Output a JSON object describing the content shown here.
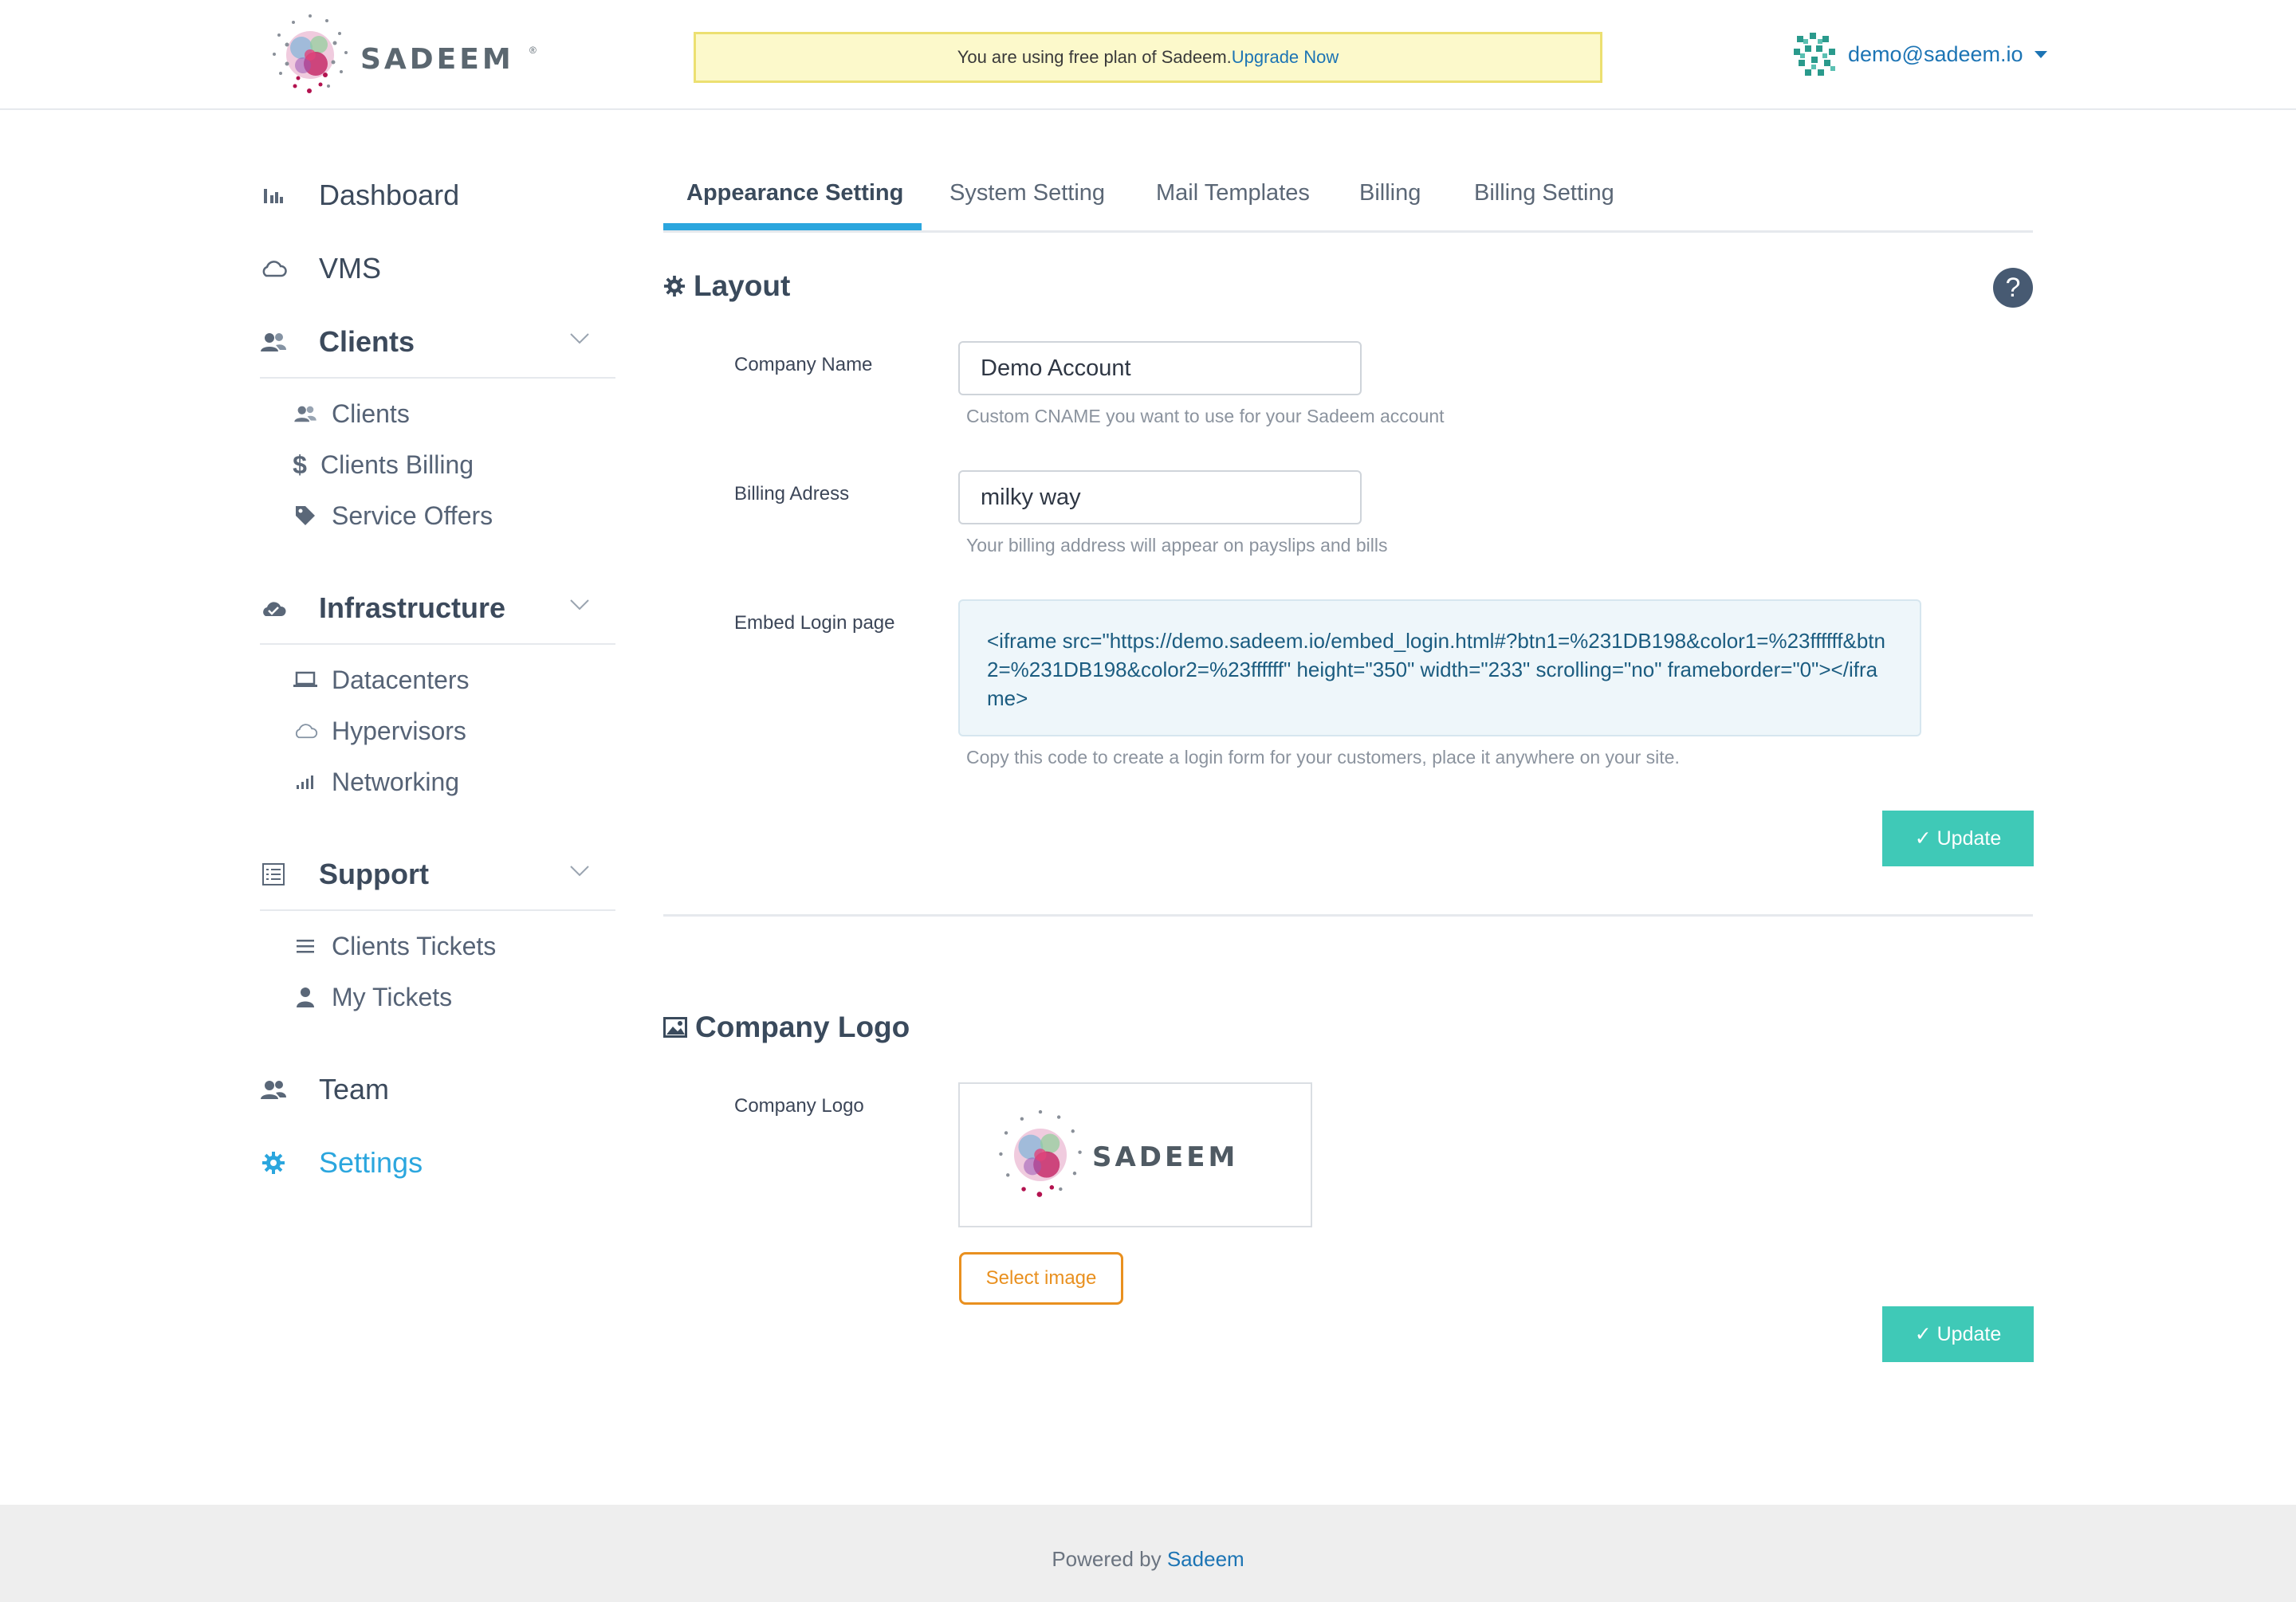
{
  "brand": {
    "name": "SADEEM",
    "reg_mark": "®"
  },
  "banner": {
    "text": "You are using free plan of Sadeem.",
    "link_label": "Upgrade Now"
  },
  "user": {
    "email": "demo@sadeem.io"
  },
  "sidebar": {
    "dashboard": "Dashboard",
    "vms": "VMS",
    "clients": {
      "label": "Clients",
      "items": [
        "Clients",
        "Clients Billing",
        "Service Offers"
      ]
    },
    "infrastructure": {
      "label": "Infrastructure",
      "items": [
        "Datacenters",
        "Hypervisors",
        "Networking"
      ]
    },
    "support": {
      "label": "Support",
      "items": [
        "Clients Tickets",
        "My Tickets"
      ]
    },
    "team": "Team",
    "settings": "Settings"
  },
  "tabs": [
    "Appearance Setting",
    "System Setting",
    "Mail Templates",
    "Billing",
    "Billing Setting"
  ],
  "layout_section": {
    "title": "Layout",
    "help": "?",
    "company_name": {
      "label": "Company Name",
      "value": "Demo Account",
      "help": "Custom CNAME you want to use for your Sadeem account"
    },
    "billing_address": {
      "label": "Billing Adress",
      "value": "milky way",
      "help": "Your billing address will appear on payslips and bills"
    },
    "embed_login": {
      "label": "Embed Login page",
      "code": "<iframe src=\"https://demo.sadeem.io/embed_login.html#?btn1=%231DB198&color1=%23ffffff&btn2=%231DB198&color2=%23ffffff\" height=\"350\" width=\"233\" scrolling=\"no\" frameborder=\"0\"></iframe>",
      "help": "Copy this code to create a login form for your customers, place it anywhere on your site."
    },
    "update_label": "✓ Update"
  },
  "logo_section": {
    "title": "Company Logo",
    "label": "Company Logo",
    "select_label": "Select image",
    "update_label": "✓ Update"
  },
  "footer": {
    "text": "Powered by ",
    "link": "Sadeem"
  },
  "colors": {
    "accent": "#2ba6de",
    "update": "#3fc9b7",
    "select": "#e9901f",
    "link": "#1c74b4"
  },
  "icons": {
    "dashboard": "bar-chart-icon",
    "vms": "cloud-icon",
    "clients": "users-icon",
    "clients_billing": "dollar-icon",
    "service_offers": "tag-icon",
    "infrastructure": "cloud-check-icon",
    "datacenters": "laptop-icon",
    "hypervisors": "cloud-icon",
    "networking": "signal-icon",
    "support": "list-icon",
    "clients_tickets": "lines-icon",
    "my_tickets": "user-icon",
    "team": "users-icon",
    "settings": "gear-icon"
  }
}
